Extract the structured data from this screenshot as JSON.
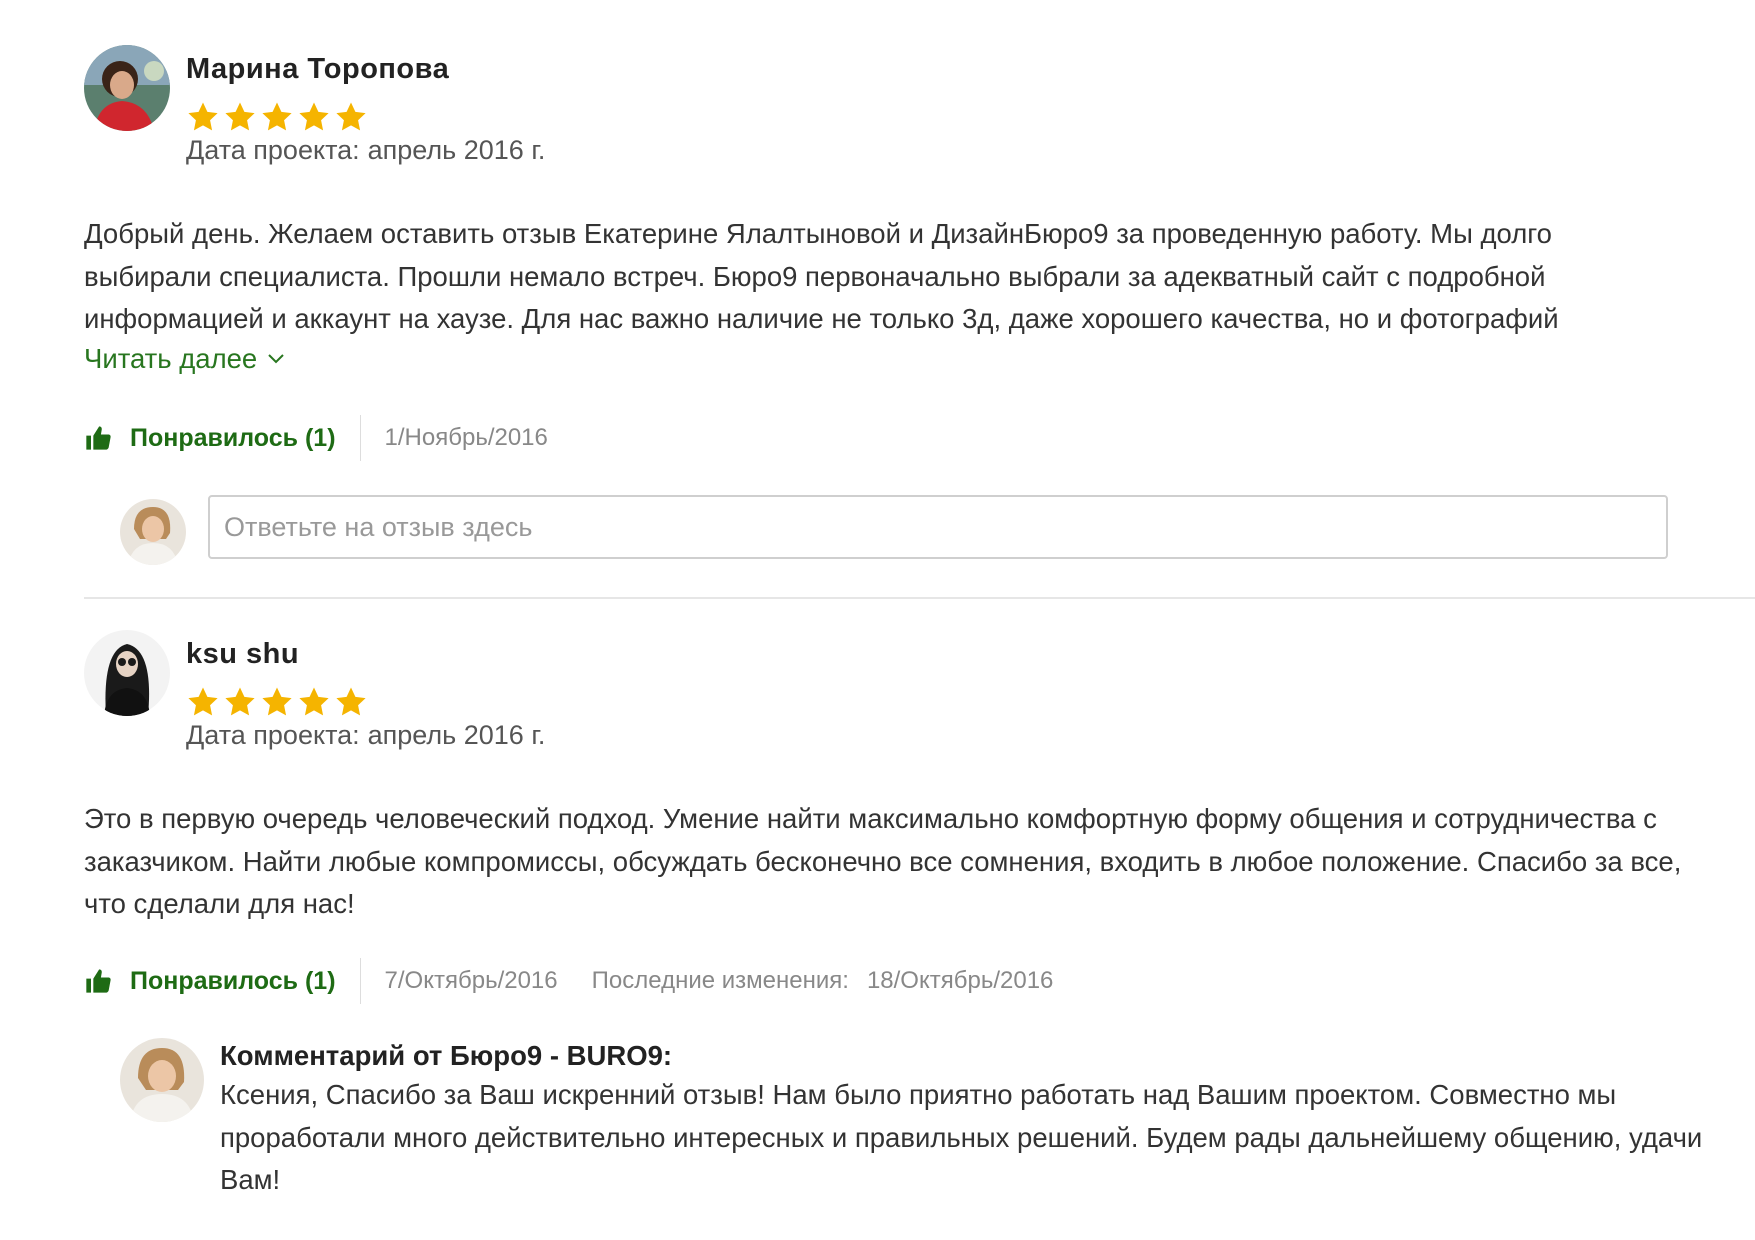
{
  "reviews": [
    {
      "reviewer": "Марина Торопова",
      "rating": 5,
      "project_date_label": "Дата проекта:",
      "project_date": "апрель 2016 г.",
      "body": "Добрый день. Желаем оставить отзыв Екатерине Ялалтыновой и ДизайнБюро9 за проведенную работу. Мы долго выбирали специалиста. Прошли немало встреч. Бюро9 первоначально выбрали за адекватный сайт с подробной информацией и аккаунт на хаузе. Для нас важно наличие не только 3д, даже хорошего качества, но и фотографий",
      "read_more": "Читать далее",
      "like_label": "Понравилось (1)",
      "date": "1/Ноябрь/2016",
      "reply_placeholder": "Ответьте на отзыв здесь"
    },
    {
      "reviewer": "ksu shu",
      "rating": 5,
      "project_date_label": "Дата проекта:",
      "project_date": "апрель 2016 г.",
      "body": "Это в первую очередь человеческий подход. Умение найти максимально комфортную форму общения и сотрудничества с заказчиком. Найти любые компромиссы, обсуждать бесконечно все сомнения, входить в любое положение. Спасибо за все, что сделали для нас!",
      "like_label": "Понравилось (1)",
      "date": "7/Октябрь/2016",
      "edited_label": "Последние изменения:",
      "edited_date": "18/Октябрь/2016",
      "comment": {
        "author": "Комментарий от Бюро9 - BURO9:",
        "text": "Ксения, Спасибо за Ваш искренний отзыв! Нам было приятно работать над Вашим проектом. Совместно мы проработали много действительно интересных и правильных решений. Будем рады дальнейшему общению, удачи Вам!"
      }
    }
  ],
  "colors": {
    "star": "#f5b400",
    "link_green": "#28761f",
    "like_green": "#1e6b14"
  }
}
